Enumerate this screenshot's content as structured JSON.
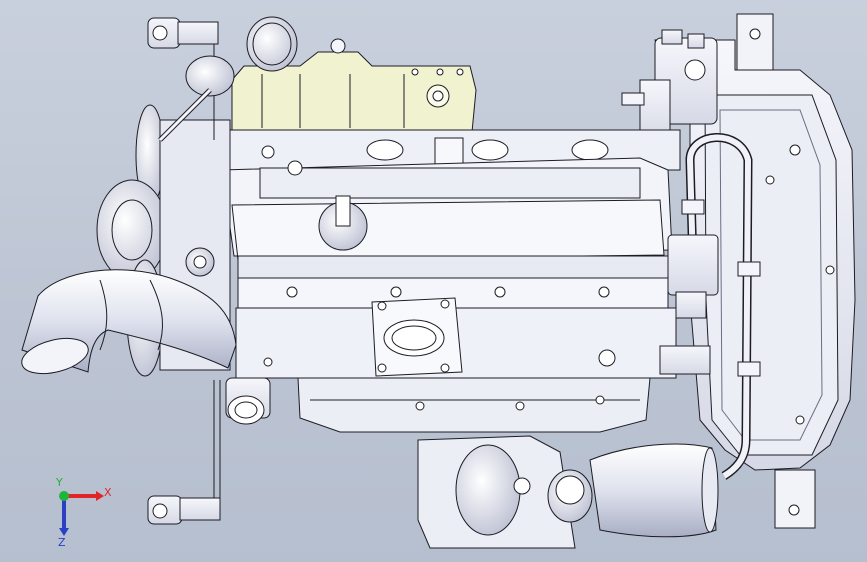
{
  "viewport": {
    "background_top": "#c9d0dd",
    "background_bottom": "#b6bfcf"
  },
  "model": {
    "body_color": "#e9ebf3",
    "edge_color": "#1c1c24",
    "head_cover_color": "#f1f2cf",
    "shadow_color": "#aeb3c6"
  },
  "triad": {
    "x_label": "X",
    "y_label": "Y",
    "z_label": "Z",
    "x_color": "#e0242a",
    "y_color": "#1fb43a",
    "z_color": "#2a3fc4"
  }
}
